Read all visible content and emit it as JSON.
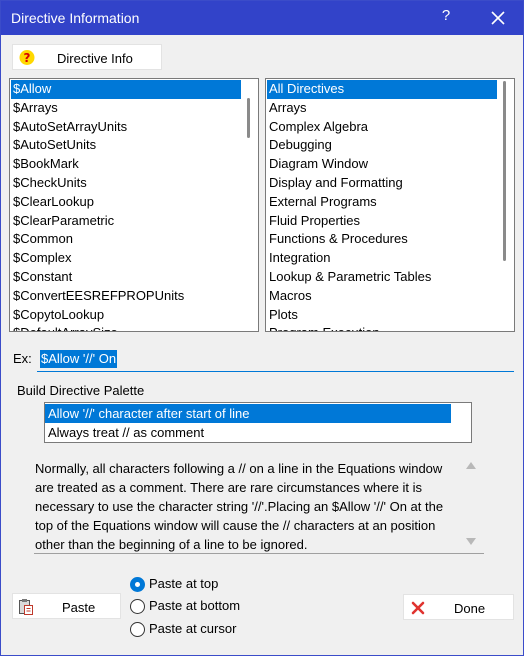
{
  "window": {
    "title": "Directive Information",
    "help_label": "?"
  },
  "directive_info_button": {
    "label": "Directive Info"
  },
  "directives_list": {
    "items": [
      "$Allow",
      "$Arrays",
      "$AutoSetArrayUnits",
      "$AutoSetUnits",
      "$BookMark",
      "$CheckUnits",
      "$ClearLookup",
      "$ClearParametric",
      "$Common",
      "$Complex",
      "$Constant",
      "$ConvertEESREFPROPUnits",
      "$CopytoLookup",
      "$DefaultArraySize"
    ],
    "selected_index": 0
  },
  "categories_list": {
    "items": [
      "All Directives",
      "Arrays",
      "Complex Algebra",
      "Debugging",
      "Diagram Window",
      "Display and Formatting",
      "External Programs",
      "Fluid Properties",
      "Functions & Procedures",
      "Integration",
      "Lookup & Parametric Tables",
      "Macros",
      "Plots",
      "Program Execution"
    ],
    "selected_index": 0
  },
  "example": {
    "label": "Ex:",
    "value": "$Allow '//' On"
  },
  "palette": {
    "label": "Build Directive Palette",
    "items": [
      "Allow '//' character after start of line",
      "Always treat // as comment"
    ],
    "selected_index": 0
  },
  "description": "Normally, all characters following a // on a line in the Equations window are treated as a comment.  There are rare circumstances where it is necessary to use the character string '//'.Placing an $Allow '//' On at the top of the Equations window will cause the // characters at an position other than the beginning of a line to be ignored.",
  "paste_button": {
    "label": "Paste"
  },
  "paste_options": {
    "items": [
      "Paste at top",
      "Paste at bottom",
      "Paste at cursor"
    ],
    "selected_index": 0
  },
  "done_button": {
    "label": "Done"
  },
  "colors": {
    "titlebar": "#3243c9",
    "selection": "#0078d7",
    "done_icon": "#e0332f",
    "info_icon": "#ffd800"
  },
  "icons": {
    "info": "question-badge-icon",
    "paste": "clipboard-paste-icon",
    "done": "red-x-icon",
    "close": "close-icon"
  }
}
